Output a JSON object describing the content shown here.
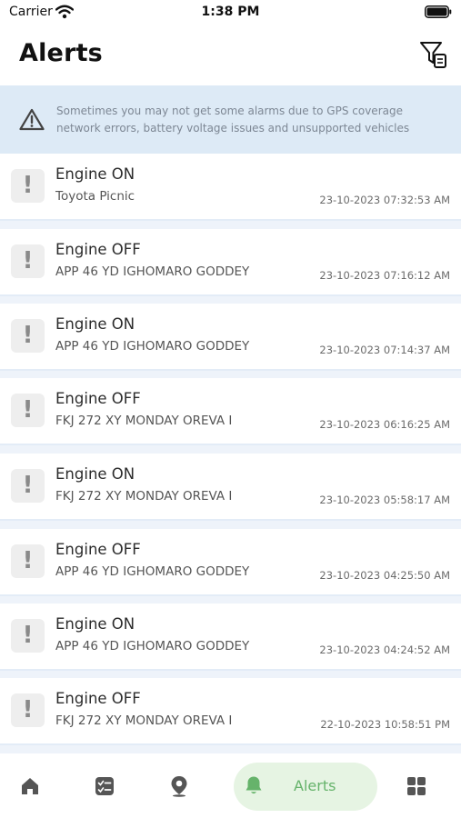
{
  "status_bar": {
    "carrier": "Carrier",
    "time": "1:38 PM"
  },
  "header": {
    "title": "Alerts",
    "filter_icon": "filter-icon"
  },
  "banner": {
    "icon": "warning-icon",
    "text": "Sometimes you may not get some alarms due to GPS coverage network errors, battery voltage issues and unsupported vehicles"
  },
  "alerts": [
    {
      "event": "Engine ON",
      "vehicle": "Toyota Picnic",
      "time": "23-10-2023 07:32:53 AM"
    },
    {
      "event": "Engine OFF",
      "vehicle": "APP 46 YD IGHOMARO GODDEY",
      "time": "23-10-2023 07:16:12 AM"
    },
    {
      "event": "Engine ON",
      "vehicle": "APP 46 YD IGHOMARO GODDEY",
      "time": "23-10-2023 07:14:37 AM"
    },
    {
      "event": "Engine OFF",
      "vehicle": "FKJ 272 XY MONDAY OREVA I",
      "time": "23-10-2023 06:16:25 AM"
    },
    {
      "event": "Engine ON",
      "vehicle": "FKJ 272 XY MONDAY OREVA I",
      "time": "23-10-2023 05:58:17 AM"
    },
    {
      "event": "Engine OFF",
      "vehicle": "APP 46 YD IGHOMARO GODDEY",
      "time": "23-10-2023 04:25:50 AM"
    },
    {
      "event": "Engine ON",
      "vehicle": "APP 46 YD IGHOMARO GODDEY",
      "time": "23-10-2023 04:24:52 AM"
    },
    {
      "event": "Engine OFF",
      "vehicle": "FKJ 272 XY MONDAY OREVA I",
      "time": "22-10-2023 10:58:51 PM"
    }
  ],
  "alert_icon": "exclamation-icon",
  "tabbar": {
    "tabs": [
      {
        "icon": "home-icon"
      },
      {
        "icon": "checklist-icon"
      },
      {
        "icon": "map-pin-icon"
      },
      {
        "icon": "bell-icon",
        "label": "Alerts",
        "active": true
      },
      {
        "icon": "grid-icon"
      }
    ]
  },
  "colors": {
    "banner_bg": "#ddeaf6",
    "banner_text": "#7d8794",
    "active_tab_bg": "#e6f4e3",
    "active_tab": "#66b36b",
    "tab_icon": "#555555"
  }
}
